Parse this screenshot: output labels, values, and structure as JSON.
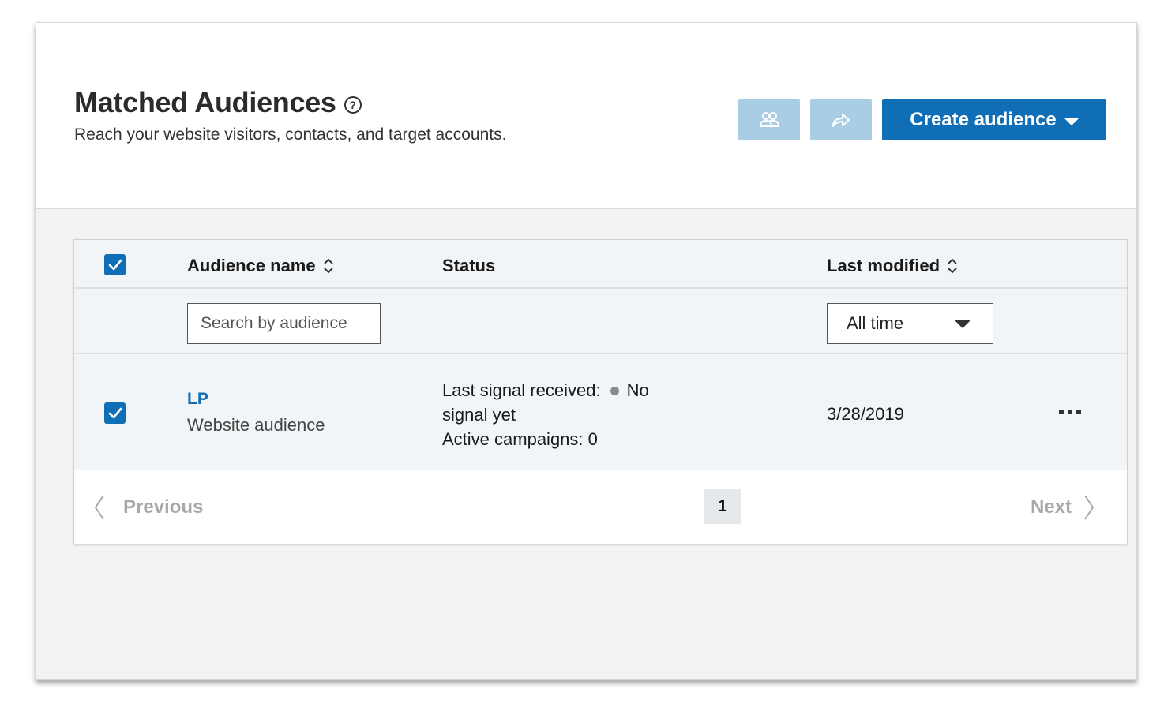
{
  "header": {
    "title": "Matched Audiences",
    "help_icon": "help-circle-icon",
    "subtitle": "Reach your website visitors, contacts, and target accounts.",
    "create_label": "Create audience"
  },
  "table": {
    "columns": {
      "name": "Audience name",
      "status": "Status",
      "modified": "Last modified"
    },
    "filters": {
      "search_placeholder": "Search by audience",
      "time_value": "All time"
    },
    "rows": [
      {
        "name": "LP",
        "type": "Website audience",
        "status_signal_label": "Last signal received:",
        "status_signal_value": "No signal yet",
        "status_campaigns": "Active campaigns: 0",
        "modified": "3/28/2019"
      }
    ]
  },
  "pager": {
    "previous": "Previous",
    "next": "Next",
    "current_page": "1"
  },
  "colors": {
    "accent": "#0f6eb5",
    "disabled_button": "#a8cde4",
    "status_dot": "#8a8a8a"
  }
}
